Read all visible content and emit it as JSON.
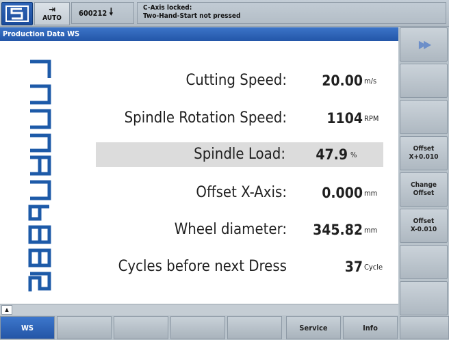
{
  "header": {
    "mode_label": "AUTO",
    "mode_icon": "mode-arrow-icon",
    "program_number": "600212",
    "message_line1": "C-Axis locked:",
    "message_line2": "Two-Hand-Start not pressed"
  },
  "screen_title": "Production Data WS",
  "brand": "Siepmann",
  "rows": [
    {
      "label": "Cutting Speed:",
      "value": "20.00",
      "unit": "m/s"
    },
    {
      "label": "Spindle Rotation Speed:",
      "value": "1104",
      "unit": "RPM"
    },
    {
      "label": "Spindle Load:",
      "value": "47.9",
      "unit": "%",
      "load_percent": 47.9
    },
    {
      "label": "Offset X-Axis:",
      "value": "0.000",
      "unit": "mm"
    },
    {
      "label": "Wheel diameter:",
      "value": "345.82",
      "unit": "mm"
    },
    {
      "label": "Cycles before next Dress",
      "value": "37",
      "unit": "Cycle"
    }
  ],
  "vertical_softkeys": [
    {
      "label": "",
      "icon": "fast-forward-icon"
    },
    {
      "label": ""
    },
    {
      "label": ""
    },
    {
      "label": "Offset\nX+0.010"
    },
    {
      "label": "Change\nOffset"
    },
    {
      "label": "Offset\nX-0.010"
    },
    {
      "label": ""
    },
    {
      "label": ""
    }
  ],
  "horizontal_softkeys": [
    {
      "label": "WS",
      "active": true
    },
    {
      "label": ""
    },
    {
      "label": ""
    },
    {
      "label": ""
    },
    {
      "label": ""
    },
    {
      "label": "Service"
    },
    {
      "label": "Info"
    },
    {
      "label": ""
    }
  ],
  "colors": {
    "accent": "#2a5fb2",
    "load_bar": "#49b52a",
    "brand_blue": "#1d5aa8"
  }
}
